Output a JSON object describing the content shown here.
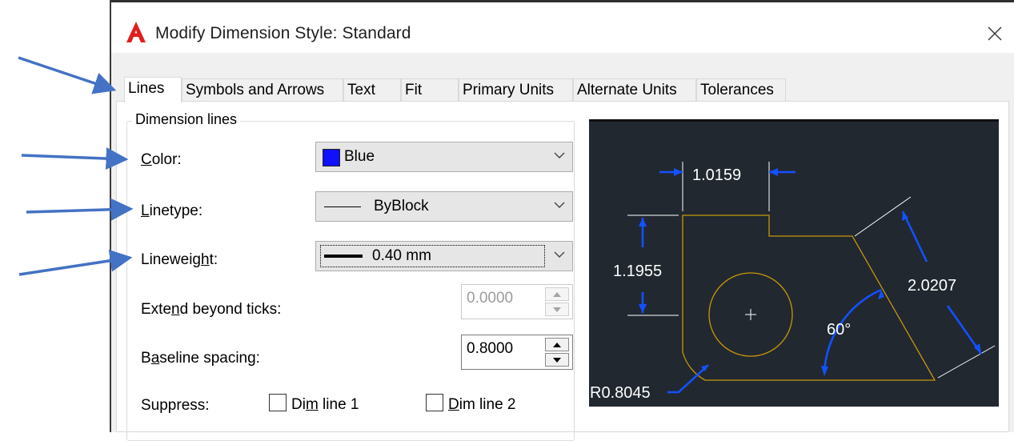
{
  "dialog": {
    "title": "Modify Dimension Style: Standard",
    "close_glyph": "✕"
  },
  "tabs": [
    {
      "label": "Lines",
      "active": true
    },
    {
      "label": "Symbols and Arrows",
      "active": false
    },
    {
      "label": "Text",
      "active": false
    },
    {
      "label": "Fit",
      "active": false
    },
    {
      "label": "Primary Units",
      "active": false
    },
    {
      "label": "Alternate Units",
      "active": false
    },
    {
      "label": "Tolerances",
      "active": false
    }
  ],
  "dimension_lines": {
    "group_label": "Dimension lines",
    "color": {
      "label_pre": "",
      "label_ul": "C",
      "label_post": "olor:",
      "value": "Blue",
      "swatch": "#1010ff"
    },
    "linetype": {
      "label_pre": "",
      "label_ul": "L",
      "label_post": "inetype:",
      "value": "ByBlock"
    },
    "lineweight": {
      "label_pre": "Lineweig",
      "label_ul": "h",
      "label_post": "t:",
      "value": "0.40 mm"
    },
    "extend": {
      "label_pre": "Exte",
      "label_ul": "n",
      "label_post": "d beyond ticks:",
      "value": "0.0000"
    },
    "baseline": {
      "label_pre": "B",
      "label_ul": "a",
      "label_post": "seline spacing:",
      "value": "0.8000"
    },
    "suppress": {
      "label": "Suppress:",
      "dim1": {
        "label_pre": "Di",
        "label_ul": "m",
        "label_post": " line 1",
        "checked": false
      },
      "dim2": {
        "label_pre": "",
        "label_ul": "D",
        "label_post": "im line 2",
        "checked": false
      }
    }
  },
  "preview": {
    "dim_top": "1.0159",
    "dim_left": "1.1955",
    "dim_right": "2.0207",
    "angle": "60°",
    "radius": "R0.8045",
    "colors": {
      "background": "#212830",
      "geometry": "#c8960a",
      "dimension": "#1450ff",
      "text": "#ffffff"
    }
  },
  "annotation_arrow_color": "#4472c4"
}
